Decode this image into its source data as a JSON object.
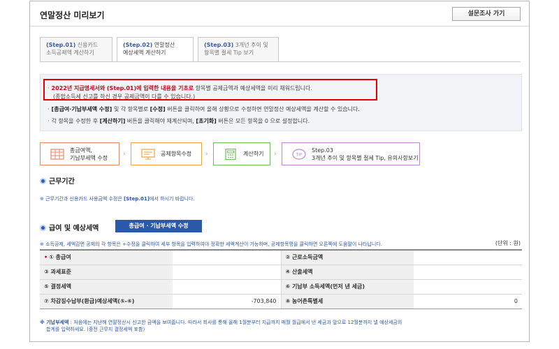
{
  "header": {
    "title": "연말정산 미리보기",
    "survey_button": "설문조사 가기"
  },
  "tabs": [
    {
      "step": "(Step.01)",
      "line1": " 신용카드",
      "line2": "소득공제액 계산하기"
    },
    {
      "step": "(Step.02)",
      "line1": " 연말정산",
      "line2": "예상세액 계산하기"
    },
    {
      "step": "(Step.03)",
      "line1": " 3개년 추이 및",
      "line2": "항목별 절세 Tip 보기"
    }
  ],
  "notice": {
    "line1_red": "2022년 지급명세서와 (Step.01)에 입력한 내용을 기초로",
    "line1_rest": " 항목별 공제금액과 예상세액을 미리 채워드립니다.",
    "line2": "(종합소득세 신고를 하신 경우 공제금액이 다를 수 있습니다.)",
    "line3_b1": "[총급여·기납부세액 수정]",
    "line3_m1": " 및 각 항목별로 ",
    "line3_b2": "[수정]",
    "line3_m2": " 버튼을 클릭하여 올해 상황으로 수정하면 연말정산 예상세액을 계산할 수 있습니다.",
    "line4_m1": "각 항목을 수정한 후 ",
    "line4_b1": "[계산하기]",
    "line4_m2": " 버튼을 클릭해야 재계산되며, ",
    "line4_b2": "[초기화]",
    "line4_m3": " 버튼은 모든 항목을 0 으로 설정합니다."
  },
  "steps": [
    {
      "line1": "총급여액,",
      "line2": "기납부세액 수정",
      "icon": "calendar-grid-icon",
      "color": "#e9876a"
    },
    {
      "line1": "공제항목수정",
      "line2": "",
      "icon": "monitor-icon",
      "color": "#f0a23a"
    },
    {
      "line1": "계산하기",
      "line2": "",
      "icon": "calculator-icon",
      "color": "#6cbf5a"
    },
    {
      "line1": "Step.03",
      "line2": "3개년 추이 및 항목별 절세 Tip, 유의사항보기",
      "icon": "tip-icon",
      "color": "#b88ad6"
    }
  ],
  "section_work": {
    "title": "근무기간",
    "note_prefix": "※ 근무기간과 신용카드 사용금액 수정은 ",
    "note_bold": "[Step.01]",
    "note_suffix": "에서 하시기 바랍니다."
  },
  "section_salary": {
    "title": "급여 및 예상세액",
    "edit_button": "총급여 · 기납부세액 수정",
    "note": "※ 소득공제, 세액감면 공제의 각 항목은 +수정을 클릭하여 세부 항목을 입력하여야 정확한 세액계산이 가능하며, 공제항목명을 클릭하면 오른쪽에 도움말이 나타납니다.",
    "unit": "(단위 : 원)"
  },
  "table": [
    {
      "left_label": "① 총급여",
      "left_required": true,
      "left_value": "",
      "right_label": "② 근로소득금액",
      "right_value": ""
    },
    {
      "left_label": "③ 과세표준",
      "left_required": false,
      "left_value": "",
      "right_label": "④ 산출세액",
      "right_value": ""
    },
    {
      "left_label": "⑤ 결정세액",
      "left_required": false,
      "left_value": "",
      "right_label": "⑥ 기납부 소득세액(먼저 낸 세금)",
      "right_value": ""
    },
    {
      "left_label": "⑦ 차감징수납부(환급)예상세액(⑤-⑥)",
      "left_required": false,
      "left_value": "-703,840",
      "right_label": "⑧ 농어촌특별세",
      "right_value": "0"
    }
  ],
  "footnote": {
    "bold": "※ 기납부세액",
    "line1": " : 처음에는 지난해 연말정산시 신고한 금액을 보여줍니다. 따라서 회사를 통해 올해 1월분부터 지급까지 매월 월급에서 낸 세금과 앞으로 12월분까지 낼 예상세금의",
    "line2": "합계를 입력하세요. (중전 근무지 결정세액 포함)"
  }
}
